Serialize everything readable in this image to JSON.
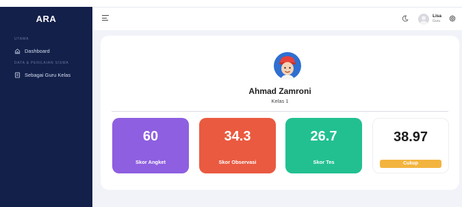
{
  "app": {
    "brand": "ARA"
  },
  "sidebar": {
    "sections": [
      {
        "label": "UTAMA"
      },
      {
        "label": "DATA & PENILAIAN SISWA"
      }
    ],
    "items": [
      {
        "label": "Dashboard",
        "icon": "home-icon"
      },
      {
        "label": "Sebagai Guru Kelas",
        "icon": "clipboard-icon"
      }
    ]
  },
  "header": {
    "user": {
      "name": "Lisa",
      "role": "Guru"
    }
  },
  "profile": {
    "name": "Ahmad Zamroni",
    "class": "Kelas 1"
  },
  "stats": [
    {
      "value": "60",
      "label": "Skor Angket",
      "color": "#8e5fe0"
    },
    {
      "value": "34.3",
      "label": "Skor Observasi",
      "color": "#ea5a40"
    },
    {
      "value": "26.7",
      "label": "Skor Tes",
      "color": "#22c091"
    },
    {
      "value": "38.97",
      "label": "Cukup",
      "color": "#f3b43f"
    }
  ]
}
